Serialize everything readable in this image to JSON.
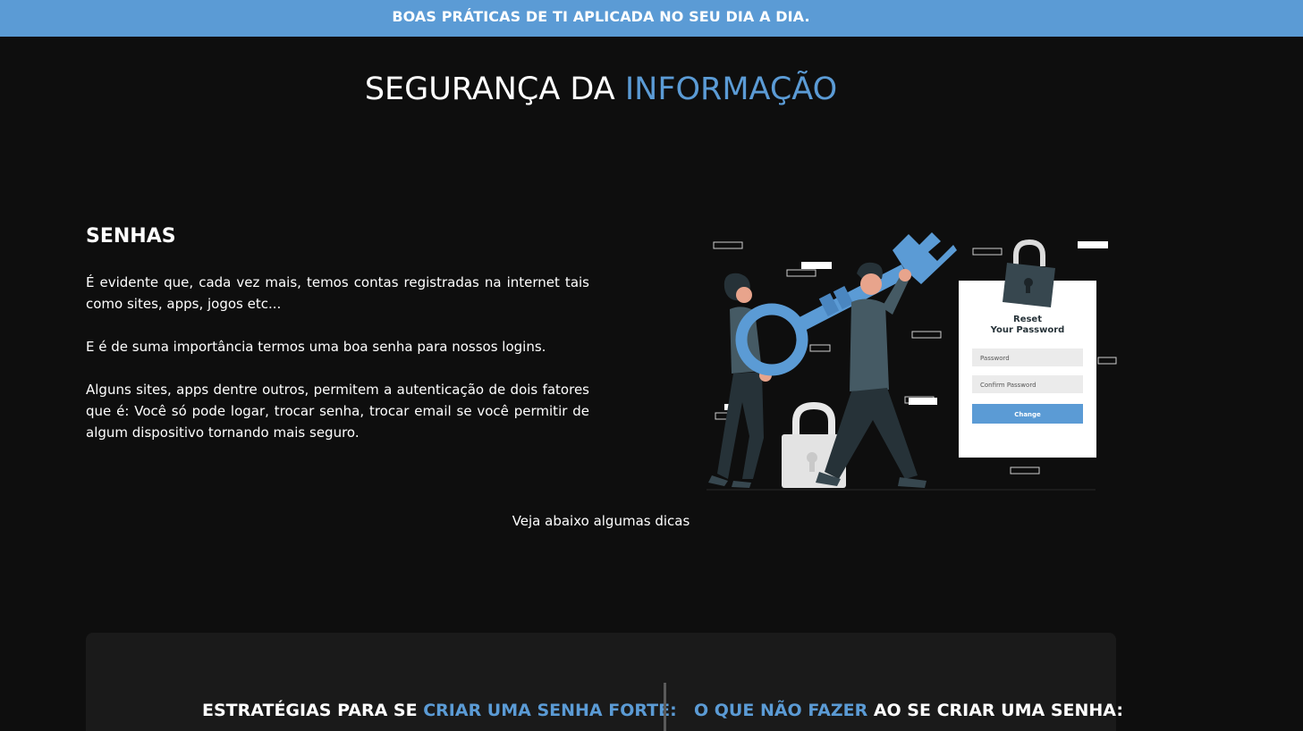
{
  "banner": {
    "text": "BOAS PRÁTICAS DE TI APLICADA NO SEU DIA A DIA."
  },
  "title": {
    "part1": "SEGURANÇA DA ",
    "part2": "INFORMAÇÃO"
  },
  "section": {
    "heading": "SENHAS",
    "paragraphs": [
      "É evidente que, cada vez mais, temos contas registradas na internet tais como sites, apps, jogos etc...",
      "E é de suma importância termos uma boa senha para nossos logins.",
      "Alguns sites, apps dentre outros, permitem a autenticação de dois fatores que é: Você só pode logar, trocar senha, trocar email se você permitir de algum dispositivo tornando mais seguro."
    ]
  },
  "illustration": {
    "card_title_line1": "Reset",
    "card_title_line2": "Your Password",
    "field1": "Password",
    "field2": "Confirm Password",
    "button": "Change"
  },
  "hint": "Veja abaixo algumas dicas",
  "tips": {
    "left_prefix": "ESTRATÉGIAS PARA SE ",
    "left_accent": "CRIAR UMA SENHA FORTE:",
    "right_accent": "O QUE NÃO FAZER",
    "right_suffix": " AO SE CRIAR UMA SENHA:"
  },
  "colors": {
    "accent": "#5b9bd5",
    "background": "#0e0e0e",
    "panel": "#1a1a1a"
  }
}
